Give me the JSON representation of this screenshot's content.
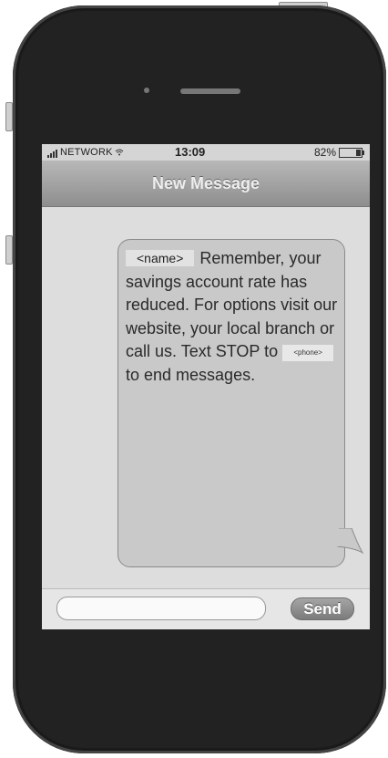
{
  "status_bar": {
    "carrier": "NETWORK",
    "time": "13:09",
    "battery": "82%"
  },
  "header": {
    "title": "New Message"
  },
  "message": {
    "name_placeholder": "<name>",
    "line1_rest": "Remember,",
    "body_main": "your savings account rate has reduced. For options visit our website, your local branch or call us.",
    "stop_prefix": "Text STOP to",
    "phone_placeholder": "<phone>",
    "stop_suffix": "to end messages."
  },
  "composer": {
    "send_label": "Send"
  },
  "icons": [
    "signal-bars-icon",
    "wifi-icon",
    "battery-icon",
    "camera-icon",
    "speaker-icon"
  ]
}
